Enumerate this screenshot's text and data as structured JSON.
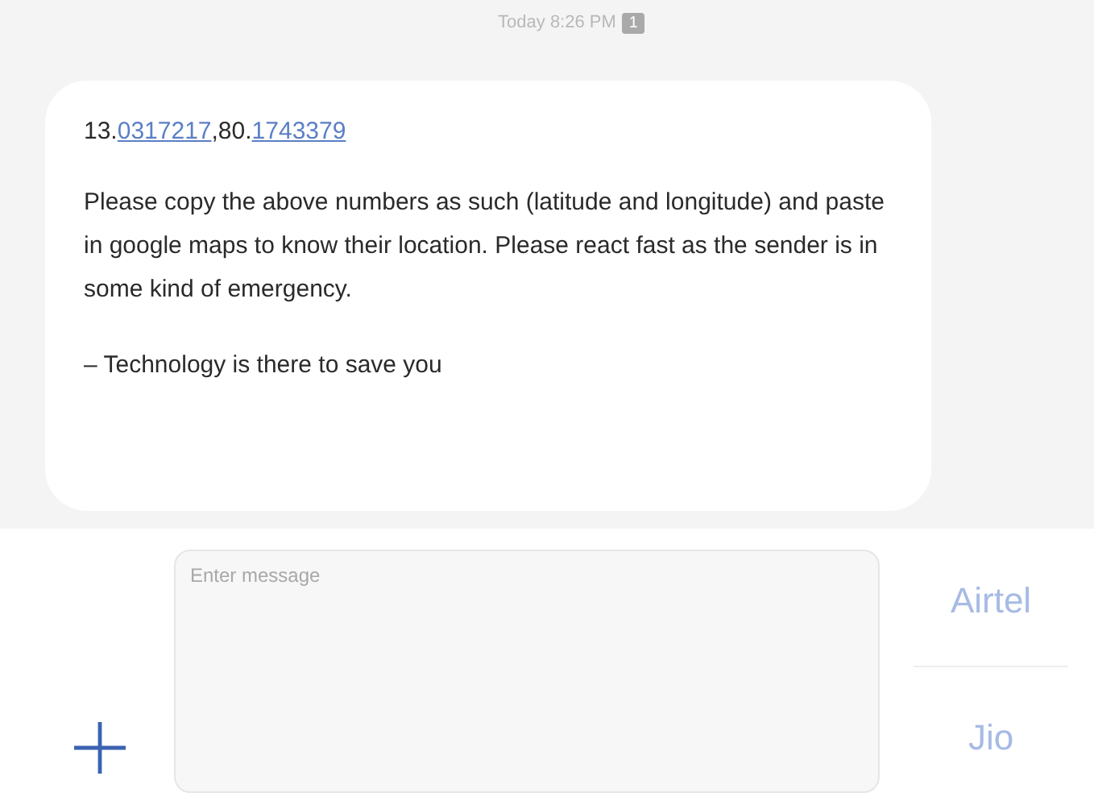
{
  "timestamp": {
    "time": "Today 8:26 PM",
    "sim_badge": "1"
  },
  "message": {
    "coordinates": [
      {
        "kind": "plain",
        "text": "13."
      },
      {
        "kind": "link",
        "text": "0317217"
      },
      {
        "kind": "plain",
        "text": ",80."
      },
      {
        "kind": "link",
        "text": "1743379"
      }
    ],
    "paragraphs": [
      "Please copy the above numbers as such (latitude and longitude) and paste in google maps to know their location. Please react fast as the sender is in some kind of emergency.",
      "– Technology is there to save you"
    ]
  },
  "composer": {
    "placeholder": "Enter message",
    "sim_buttons": [
      "Airtel",
      "Jio"
    ]
  }
}
